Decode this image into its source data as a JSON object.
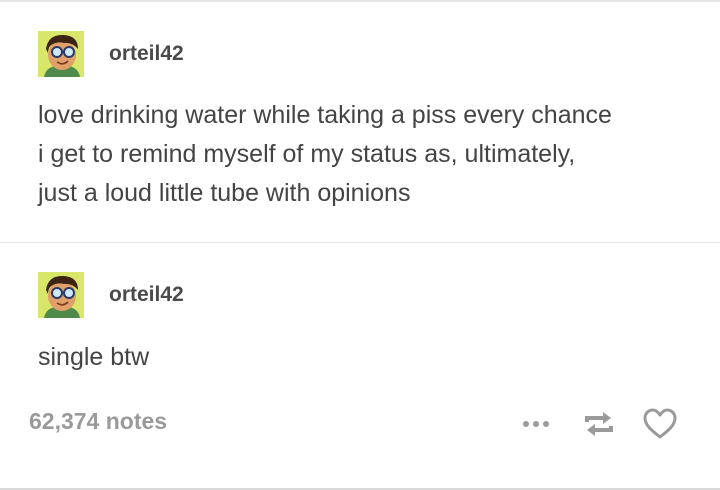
{
  "posts": [
    {
      "username": "orteil42",
      "text": "love drinking water while taking a piss every chance\ni get to remind myself of my status as, ultimately,\njust a loud little tube with opinions",
      "avatar_icon": "cartoon-face-with-glasses"
    },
    {
      "username": "orteil42",
      "text": "single btw",
      "avatar_icon": "cartoon-face-with-glasses"
    }
  ],
  "footer": {
    "notes": "62,374 notes",
    "icons": [
      "more-icon",
      "reblog-icon",
      "like-icon"
    ]
  },
  "colors": {
    "avatar_bg": "#d8e76a",
    "text": "#444444",
    "notes": "#9a9a9a",
    "icons": "#9a9a9a"
  }
}
